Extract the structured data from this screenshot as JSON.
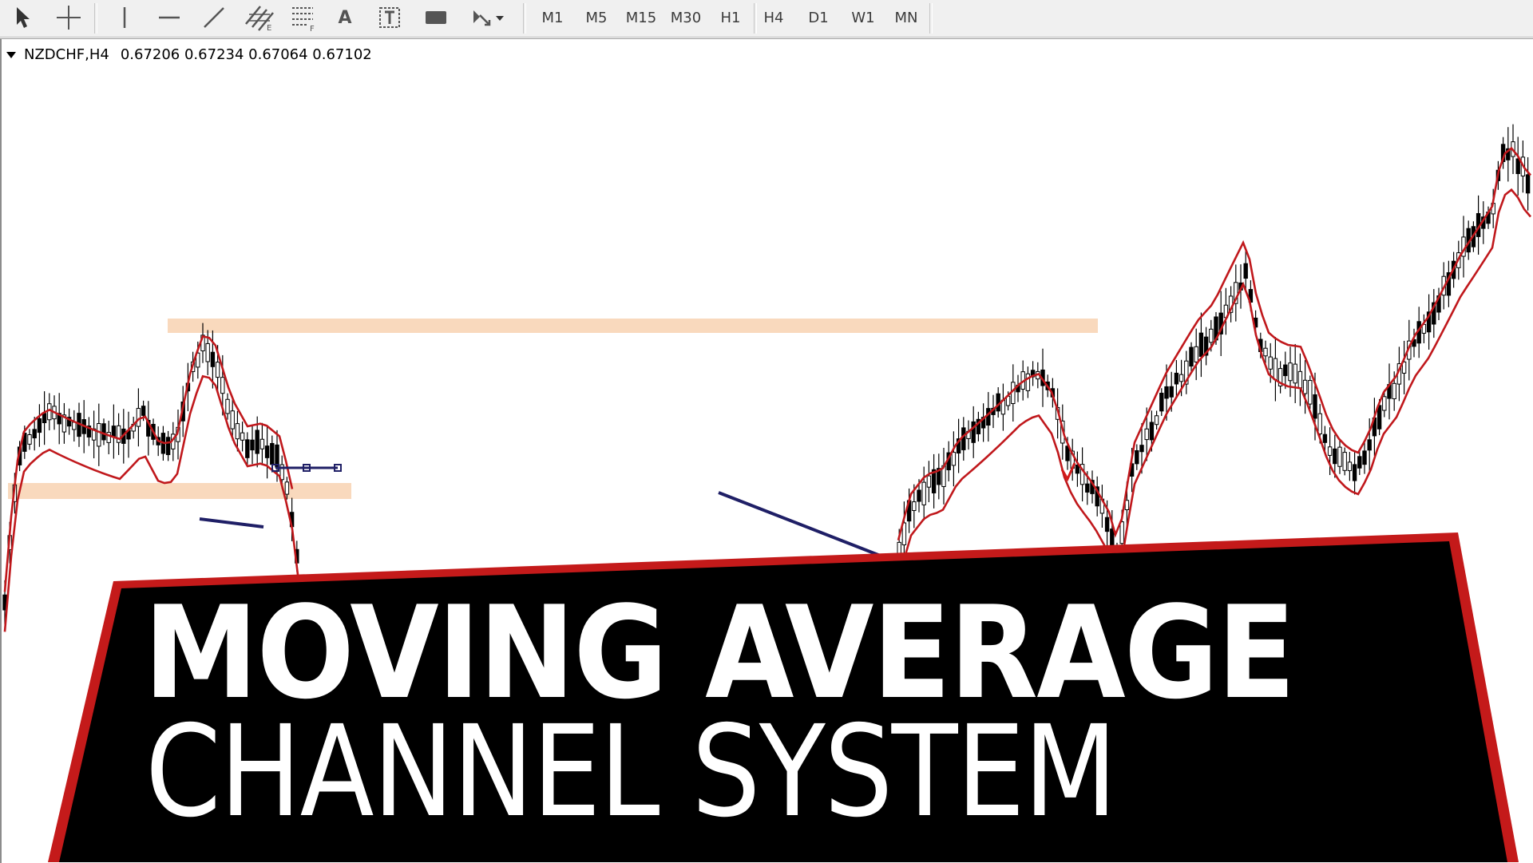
{
  "toolbar": {
    "tools": [
      {
        "name": "cursor-icon"
      },
      {
        "name": "crosshair-icon"
      },
      {
        "name": "vertical-line-icon"
      },
      {
        "name": "horizontal-line-icon"
      },
      {
        "name": "trendline-icon"
      },
      {
        "name": "equidistant-channel-icon"
      },
      {
        "name": "fibonacci-icon"
      },
      {
        "name": "text-icon"
      },
      {
        "name": "text-label-icon"
      },
      {
        "name": "rectangle-icon"
      },
      {
        "name": "arrows-dropdown-icon"
      }
    ],
    "text_tool_label": "A",
    "timeframes": [
      "M1",
      "M5",
      "M15",
      "M30",
      "H1",
      "H4",
      "D1",
      "W1",
      "MN"
    ]
  },
  "chart": {
    "symbol_label": "NZDCHF,H4",
    "ohlc": "0.67206 0.67234 0.67064 0.67102",
    "ma_color": "#c0181c",
    "zone_color": "#f9d9bd",
    "drawing_color": "#1f1f66"
  },
  "banner": {
    "line1": "MOVING AVERAGE",
    "line2": "CHANNEL SYSTEM",
    "background": "#000000",
    "border_color": "#c41a1a"
  }
}
